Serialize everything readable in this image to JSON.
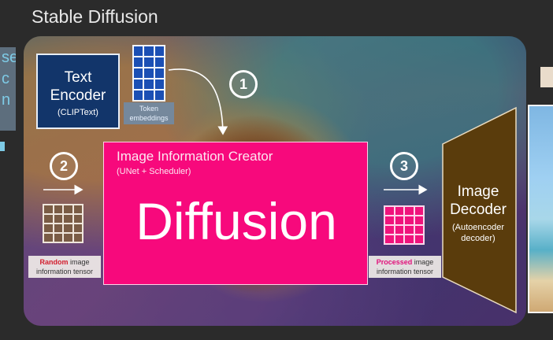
{
  "page": {
    "title": "Stable Diffusion"
  },
  "left_fragment": {
    "lines": [
      "se",
      "c",
      "n"
    ]
  },
  "text_encoder": {
    "title_line1": "Text",
    "title_line2": "Encoder",
    "subtitle": "(CLIPText)"
  },
  "token_embeddings": {
    "label_line1": "Token",
    "label_line2": "embeddings"
  },
  "steps": {
    "one": "1",
    "two": "2",
    "three": "3"
  },
  "image_information_creator": {
    "title": "Image Information Creator",
    "subtitle": "(UNet + Scheduler)",
    "big_label": "Diffusion"
  },
  "random_tensor": {
    "label_strong": "Random",
    "label_rest": " image",
    "label_line2": "information tensor"
  },
  "processed_tensor": {
    "label_strong": "Processed",
    "label_rest": " image",
    "label_line2": "information tensor"
  },
  "image_decoder": {
    "title_line1": "Image",
    "title_line2": "Decoder",
    "sub_line1": "(Autoencoder",
    "sub_line2": "decoder)"
  },
  "colors": {
    "creator_box": "#f7097c",
    "text_encoder_box": "#12356a",
    "decoder_shape": "#5a3c0c",
    "processed_cells": "#f0137c",
    "token_cells": "#1b4fb4"
  }
}
